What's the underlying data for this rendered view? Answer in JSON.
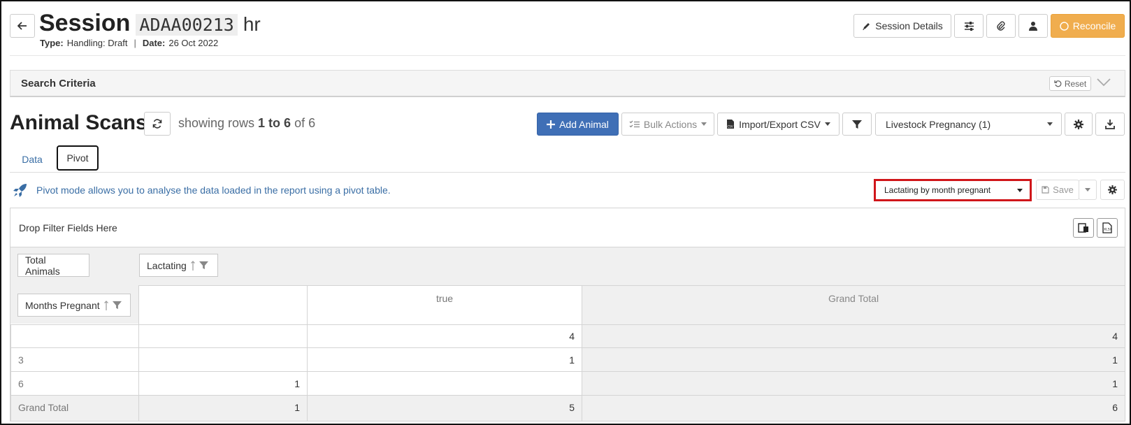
{
  "header": {
    "title_word": "Session",
    "session_code": "ADAA00213",
    "session_suffix": "hr",
    "type_label": "Type:",
    "type_value": "Handling: Draft",
    "separator": "|",
    "date_label": "Date:",
    "date_value": "26 Oct 2022",
    "session_details_label": "Session Details",
    "reconcile_label": "Reconcile",
    "reconcile_color": "#f0ad4e"
  },
  "search": {
    "title": "Search Criteria",
    "reset_label": "Reset"
  },
  "scans": {
    "title": "Animal Scans",
    "showing_prefix": "showing rows",
    "showing_range": "1 to 6",
    "showing_of": "of 6",
    "add_animal_label": "Add Animal",
    "add_animal_color": "#3f6fb6",
    "bulk_actions_label": "Bulk Actions",
    "import_export_label": "Import/Export CSV",
    "report_select_value": "Livestock Pregnancy (1)"
  },
  "tabs": [
    {
      "label": "Data"
    },
    {
      "label": "Pivot"
    }
  ],
  "pivot": {
    "info_text": "Pivot mode allows you to analyse the data loaded in the report using a pivot table.",
    "layout_select_value": "Lactating by month pregnant",
    "save_label": "Save",
    "drop_filter_text": "Drop Filter Fields Here",
    "value_field": "Total Animals",
    "column_field": "Lactating",
    "row_field": "Months Pregnant",
    "columns": [
      "",
      "true",
      "Grand Total"
    ],
    "rows": [
      {
        "label": "",
        "values": [
          "",
          "4",
          "4"
        ]
      },
      {
        "label": "3",
        "values": [
          "",
          "1",
          "1"
        ]
      },
      {
        "label": "6",
        "values": [
          "1",
          "",
          "1"
        ]
      },
      {
        "label": "Grand Total",
        "values": [
          "1",
          "5",
          "6"
        ]
      }
    ]
  }
}
